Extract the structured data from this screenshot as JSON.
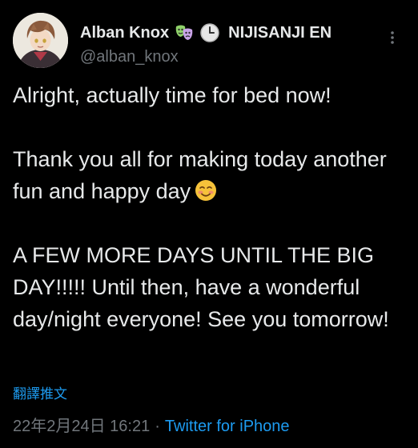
{
  "author": {
    "display_name": "Alban Knox",
    "affiliation": "NIJISANJI EN",
    "handle": "@alban_knox",
    "name_emojis": [
      "masks-emoji-icon",
      "clock-emoji-icon"
    ]
  },
  "tweet": {
    "paragraphs": [
      "Alright, actually time for bed now!",
      "Thank you all for making today another fun and happy day",
      "A FEW MORE DAYS UNTIL THE BIG DAY!!!!! Until then, have a wonderful day/night everyone! See you tomorrow!"
    ],
    "inline_emoji": "smiling-face-with-blush-icon"
  },
  "translate_label": "翻譯推文",
  "meta": {
    "timestamp": "22年2月24日 16:21",
    "separator": "·",
    "client": "Twitter for iPhone"
  },
  "colors": {
    "background": "#000000",
    "text": "#e7e9ea",
    "secondary_text": "#71767b",
    "link": "#1d9bf0"
  }
}
